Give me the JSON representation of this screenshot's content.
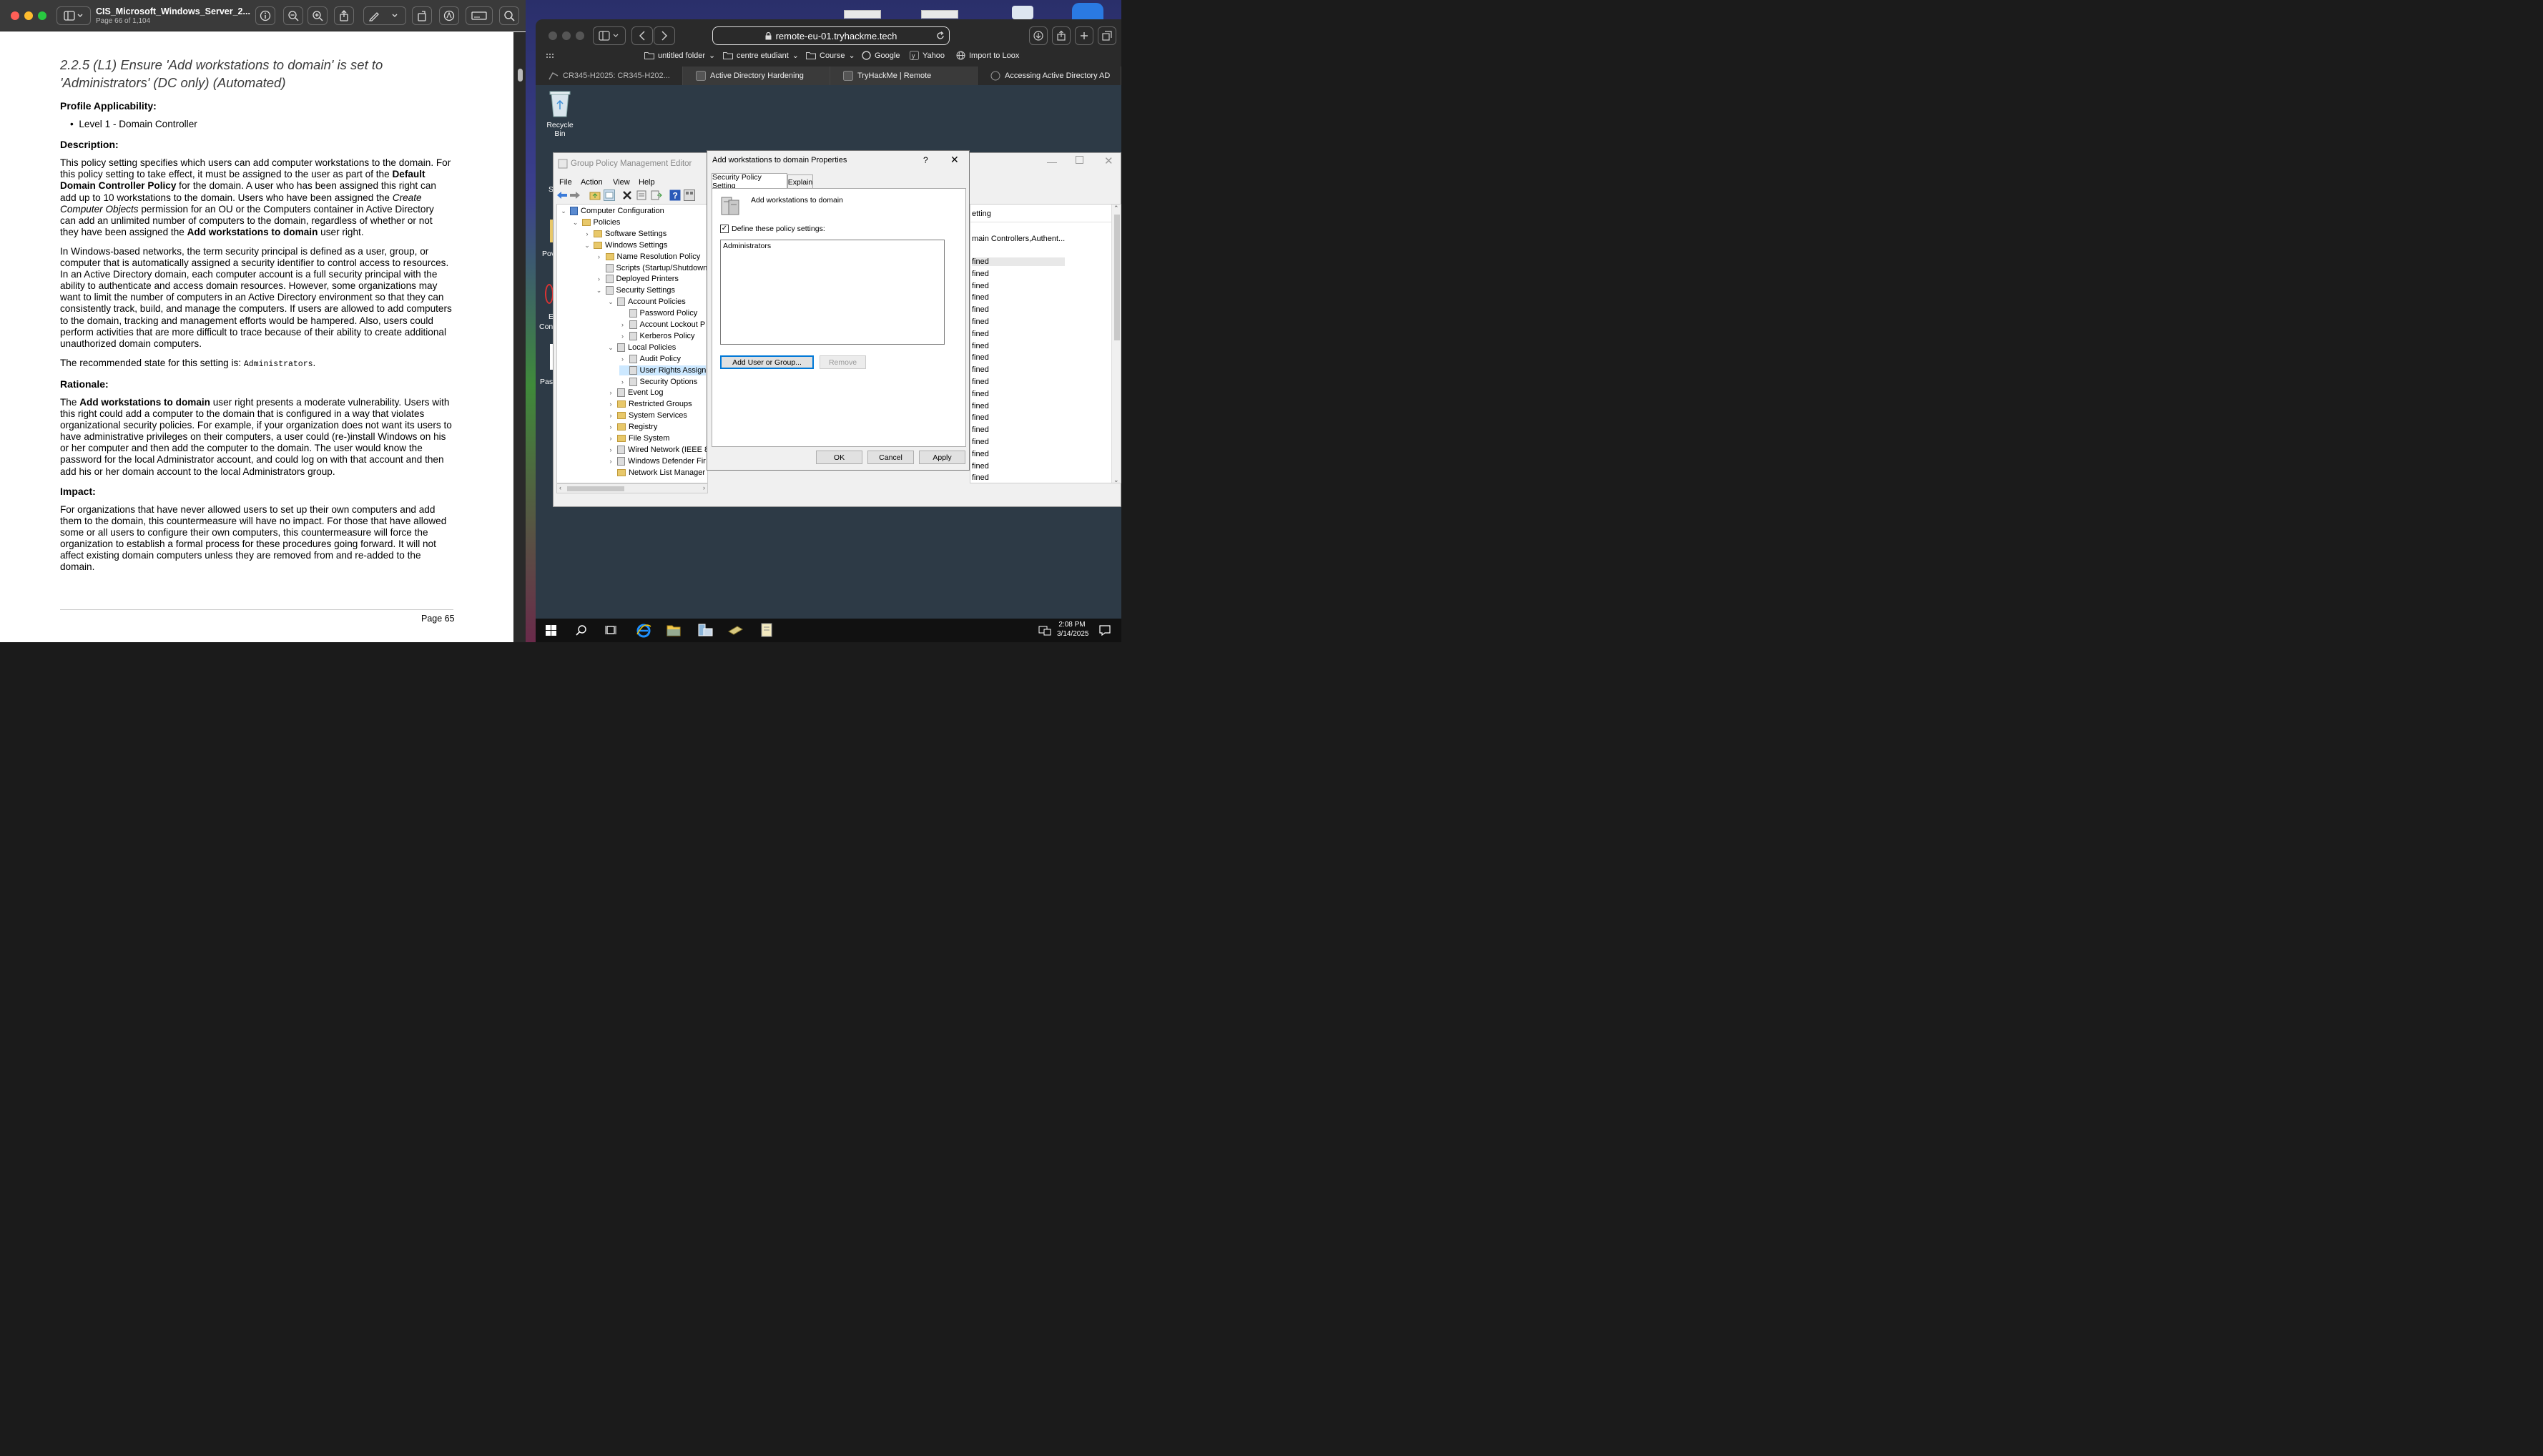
{
  "pdf": {
    "title": "CIS_Microsoft_Windows_Server_2...",
    "subtitle": "Page 66 of 1,104",
    "heading": "2.2.5 (L1) Ensure 'Add workstations to domain' is set to 'Administrators' (DC only) (Automated)",
    "profile_heading": "Profile Applicability:",
    "profile_item": "Level 1 - Domain Controller",
    "description_heading": "Description:",
    "desc_p1_a": "This policy setting specifies which users can add computer workstations to the domain. For this policy setting to take effect, it must be assigned to the user as part of the ",
    "desc_p1_b": "Default Domain Controller Policy",
    "desc_p1_c": " for the domain. A user who has been assigned this right can add up to 10 workstations to the domain. Users who have been assigned the ",
    "desc_p1_d": "Create Computer Objects",
    "desc_p1_e": " permission for an OU or the Computers container in Active Directory can add an unlimited number of computers to the domain, regardless of whether or not they have been assigned the ",
    "desc_p1_f": "Add workstations to domain",
    "desc_p1_g": " user right.",
    "desc_p2": "In Windows-based networks, the term security principal is defined as a user, group, or computer that is automatically assigned a security identifier to control access to resources. In an Active Directory domain, each computer account is a full security principal with the ability to authenticate and access domain resources. However, some organizations may want to limit the number of computers in an Active Directory environment so that they can consistently track, build, and manage the computers. If users are allowed to add computers to the domain, tracking and management efforts would be hampered. Also, users could perform activities that are more difficult to trace because of their ability to create additional unauthorized domain computers.",
    "rec_a": "The recommended state for this setting is: ",
    "rec_b": "Administrators",
    "rec_c": ".",
    "rationale_heading": "Rationale:",
    "rat_a": "The ",
    "rat_b": "Add workstations to domain",
    "rat_c": " user right presents a moderate vulnerability. Users with this right could add a computer to the domain that is configured in a way that violates organizational security policies. For example, if your organization does not want its users to have administrative privileges on their computers, a user could (re-)install Windows on his or her computer and then add the computer to the domain. The user would know the password for the local Administrator account, and could log on with that account and then add his or her domain account to the local Administrators group.",
    "impact_heading": "Impact:",
    "impact": "For organizations that have never allowed users to set up their own computers and add them to the domain, this countermeasure will have no impact. For those that have allowed some or all users to configure their own computers, this countermeasure will force the organization to establish a formal process for these procedures going forward. It will not affect existing domain computers unless they are removed from and re-added to the domain.",
    "footer_page": "Page 65"
  },
  "browser": {
    "url": "remote-eu-01.tryhackme.tech",
    "bookmarks": [
      "untitled folder",
      "centre etudiant",
      "Course",
      "Google",
      "Yahoo",
      "Import to Loox"
    ],
    "tabs": [
      "CR345-H2025: CR345-H202...",
      "Active Directory Hardening",
      "TryHackMe | Remote",
      "Accessing Active Directory AD"
    ]
  },
  "desktop": {
    "recycle_bin": "Recycle Bin",
    "partial_labels": [
      "S",
      "Pov",
      "E",
      "Con",
      "Pass"
    ]
  },
  "gpme": {
    "title": "Group Policy Management Editor",
    "menu": [
      "File",
      "Action",
      "View",
      "Help"
    ],
    "tree": [
      "Computer Configuration",
      "Policies",
      "Software Settings",
      "Windows Settings",
      "Name Resolution Policy",
      "Scripts (Startup/Shutdown",
      "Deployed Printers",
      "Security Settings",
      "Account Policies",
      "Password Policy",
      "Account Lockout P",
      "Kerberos Policy",
      "Local Policies",
      "Audit Policy",
      "User Rights Assign",
      "Security Options",
      "Event Log",
      "Restricted Groups",
      "System Services",
      "Registry",
      "File System",
      "Wired Network (IEEE 80",
      "Windows Defender Fir",
      "Network List Manager"
    ],
    "right_header": "etting",
    "right_first": "main Controllers,Authent...",
    "right_cell": "fined"
  },
  "dialog": {
    "title": "Add workstations to domain Properties",
    "help": "?",
    "tab1": "Security Policy Setting",
    "tab2": "Explain",
    "policy_name": "Add workstations to domain",
    "define_label": "Define these policy settings:",
    "list_item": "Administrators",
    "add_button": "Add User or Group...",
    "remove_button": "Remove",
    "ok": "OK",
    "cancel": "Cancel",
    "apply": "Apply"
  },
  "clock": {
    "time": "2:08 PM",
    "date": "3/14/2025"
  }
}
